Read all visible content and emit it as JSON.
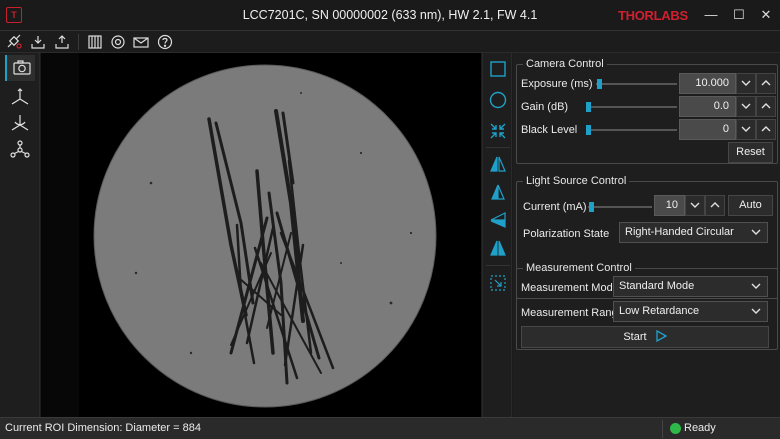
{
  "window": {
    "title": "LCC7201C, SN 00000002 (633 nm), HW 2.1, FW 4.1",
    "brand": "THORLABS",
    "app_icon_label": "T",
    "controls": {
      "minimize": "—",
      "maximize": "☐",
      "close": "✕"
    }
  },
  "toolbar": {
    "buttons": [
      "connect-icon",
      "download-icon",
      "upload-icon",
      "grid-icon",
      "target-icon",
      "mail-icon",
      "help-icon"
    ]
  },
  "leftnav": {
    "items": [
      "camera-icon",
      "axis-icon",
      "axis-rotate-icon",
      "network-icon"
    ],
    "active_index": 0
  },
  "tools": {
    "items": [
      "square-roi-icon",
      "circle-roi-icon",
      "shrink-icon",
      "rotate-left-icon",
      "rotate-right-icon",
      "flip-horizontal-icon",
      "flip-vertical-icon",
      "select-region-icon"
    ],
    "accent": "#1fa0c8"
  },
  "camera": {
    "title": "Camera Control",
    "exposure": {
      "label": "Exposure (ms)",
      "value": "10.000"
    },
    "gain": {
      "label": "Gain (dB)",
      "value": "0.0"
    },
    "black_level": {
      "label": "Black Level",
      "value": "0"
    },
    "reset_label": "Reset"
  },
  "light": {
    "title": "Light Source Control",
    "current": {
      "label": "Current (mA)",
      "value": "10"
    },
    "auto_label": "Auto",
    "polarization": {
      "label": "Polarization State",
      "value": "Right-Handed Circular"
    }
  },
  "measurement": {
    "title": "Measurement Control",
    "mode": {
      "label": "Measurement Mode",
      "value": "Standard Mode"
    },
    "range": {
      "label": "Measurement Range",
      "value": "Low Retardance"
    },
    "start_label": "Start"
  },
  "status": {
    "roi_text": "Current ROI Dimension: Diameter = 884",
    "state": "Ready",
    "state_color": "#2fb84a"
  }
}
